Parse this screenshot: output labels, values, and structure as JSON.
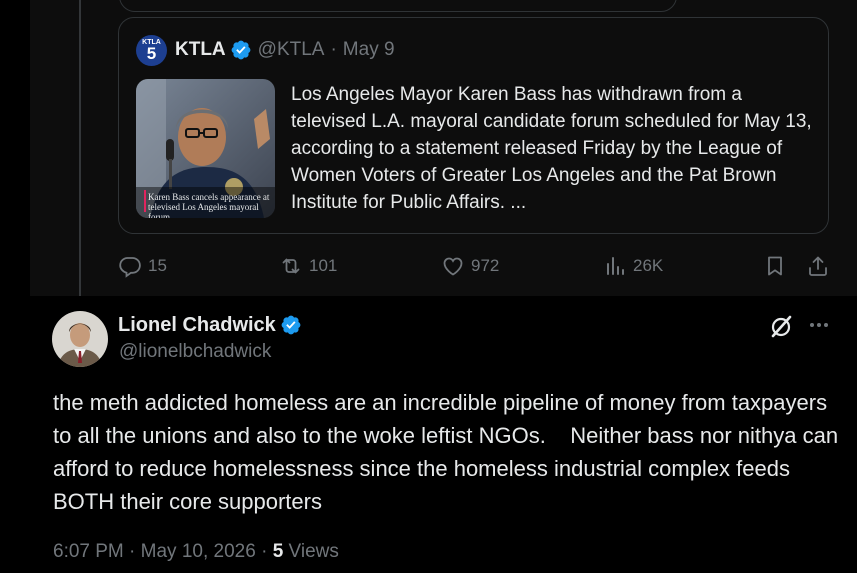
{
  "quoted": {
    "logo_text": "KTLA",
    "logo_number": "5",
    "name": "KTLA",
    "handle": "@KTLA",
    "separator": "·",
    "date": "May 9",
    "text": "Los Angeles Mayor Karen Bass has withdrawn from a televised L.A. mayoral candidate forum scheduled for May 13, according to a statement released Friday by the League of Women Voters of Greater Los Angeles and the Pat Brown Institute for Public Affairs. ...",
    "image_caption": "Karen Bass cancels appearance at televised Los Angeles mayoral forum"
  },
  "actions": {
    "replies": "15",
    "reposts": "101",
    "likes": "972",
    "views": "26K"
  },
  "tweet": {
    "author_name": "Lionel Chadwick",
    "author_handle": "@lionelbchadwick",
    "text": "the meth addicted homeless are an incredible pipeline of money from taxpayers to all the unions and also to the woke leftist NGOs.    Neither bass nor nithya can afford to reduce homelessness since the homeless industrial complex feeds BOTH their core supporters",
    "time": "6:07 PM",
    "date": "May 10, 2026",
    "separator": "·",
    "views_count": "5",
    "views_label": "Views"
  },
  "icons": {
    "verified": "verified-badge-icon",
    "reply": "reply-icon",
    "repost": "repost-icon",
    "like": "heart-icon",
    "views": "views-chart-icon",
    "bookmark": "bookmark-icon",
    "share": "share-icon",
    "grok": "grok-icon",
    "more": "more-icon"
  },
  "colors": {
    "background": "#000000",
    "text": "#e7e9ea",
    "muted": "#71767b",
    "verified": "#1d9bf0",
    "border": "#2f3336"
  }
}
